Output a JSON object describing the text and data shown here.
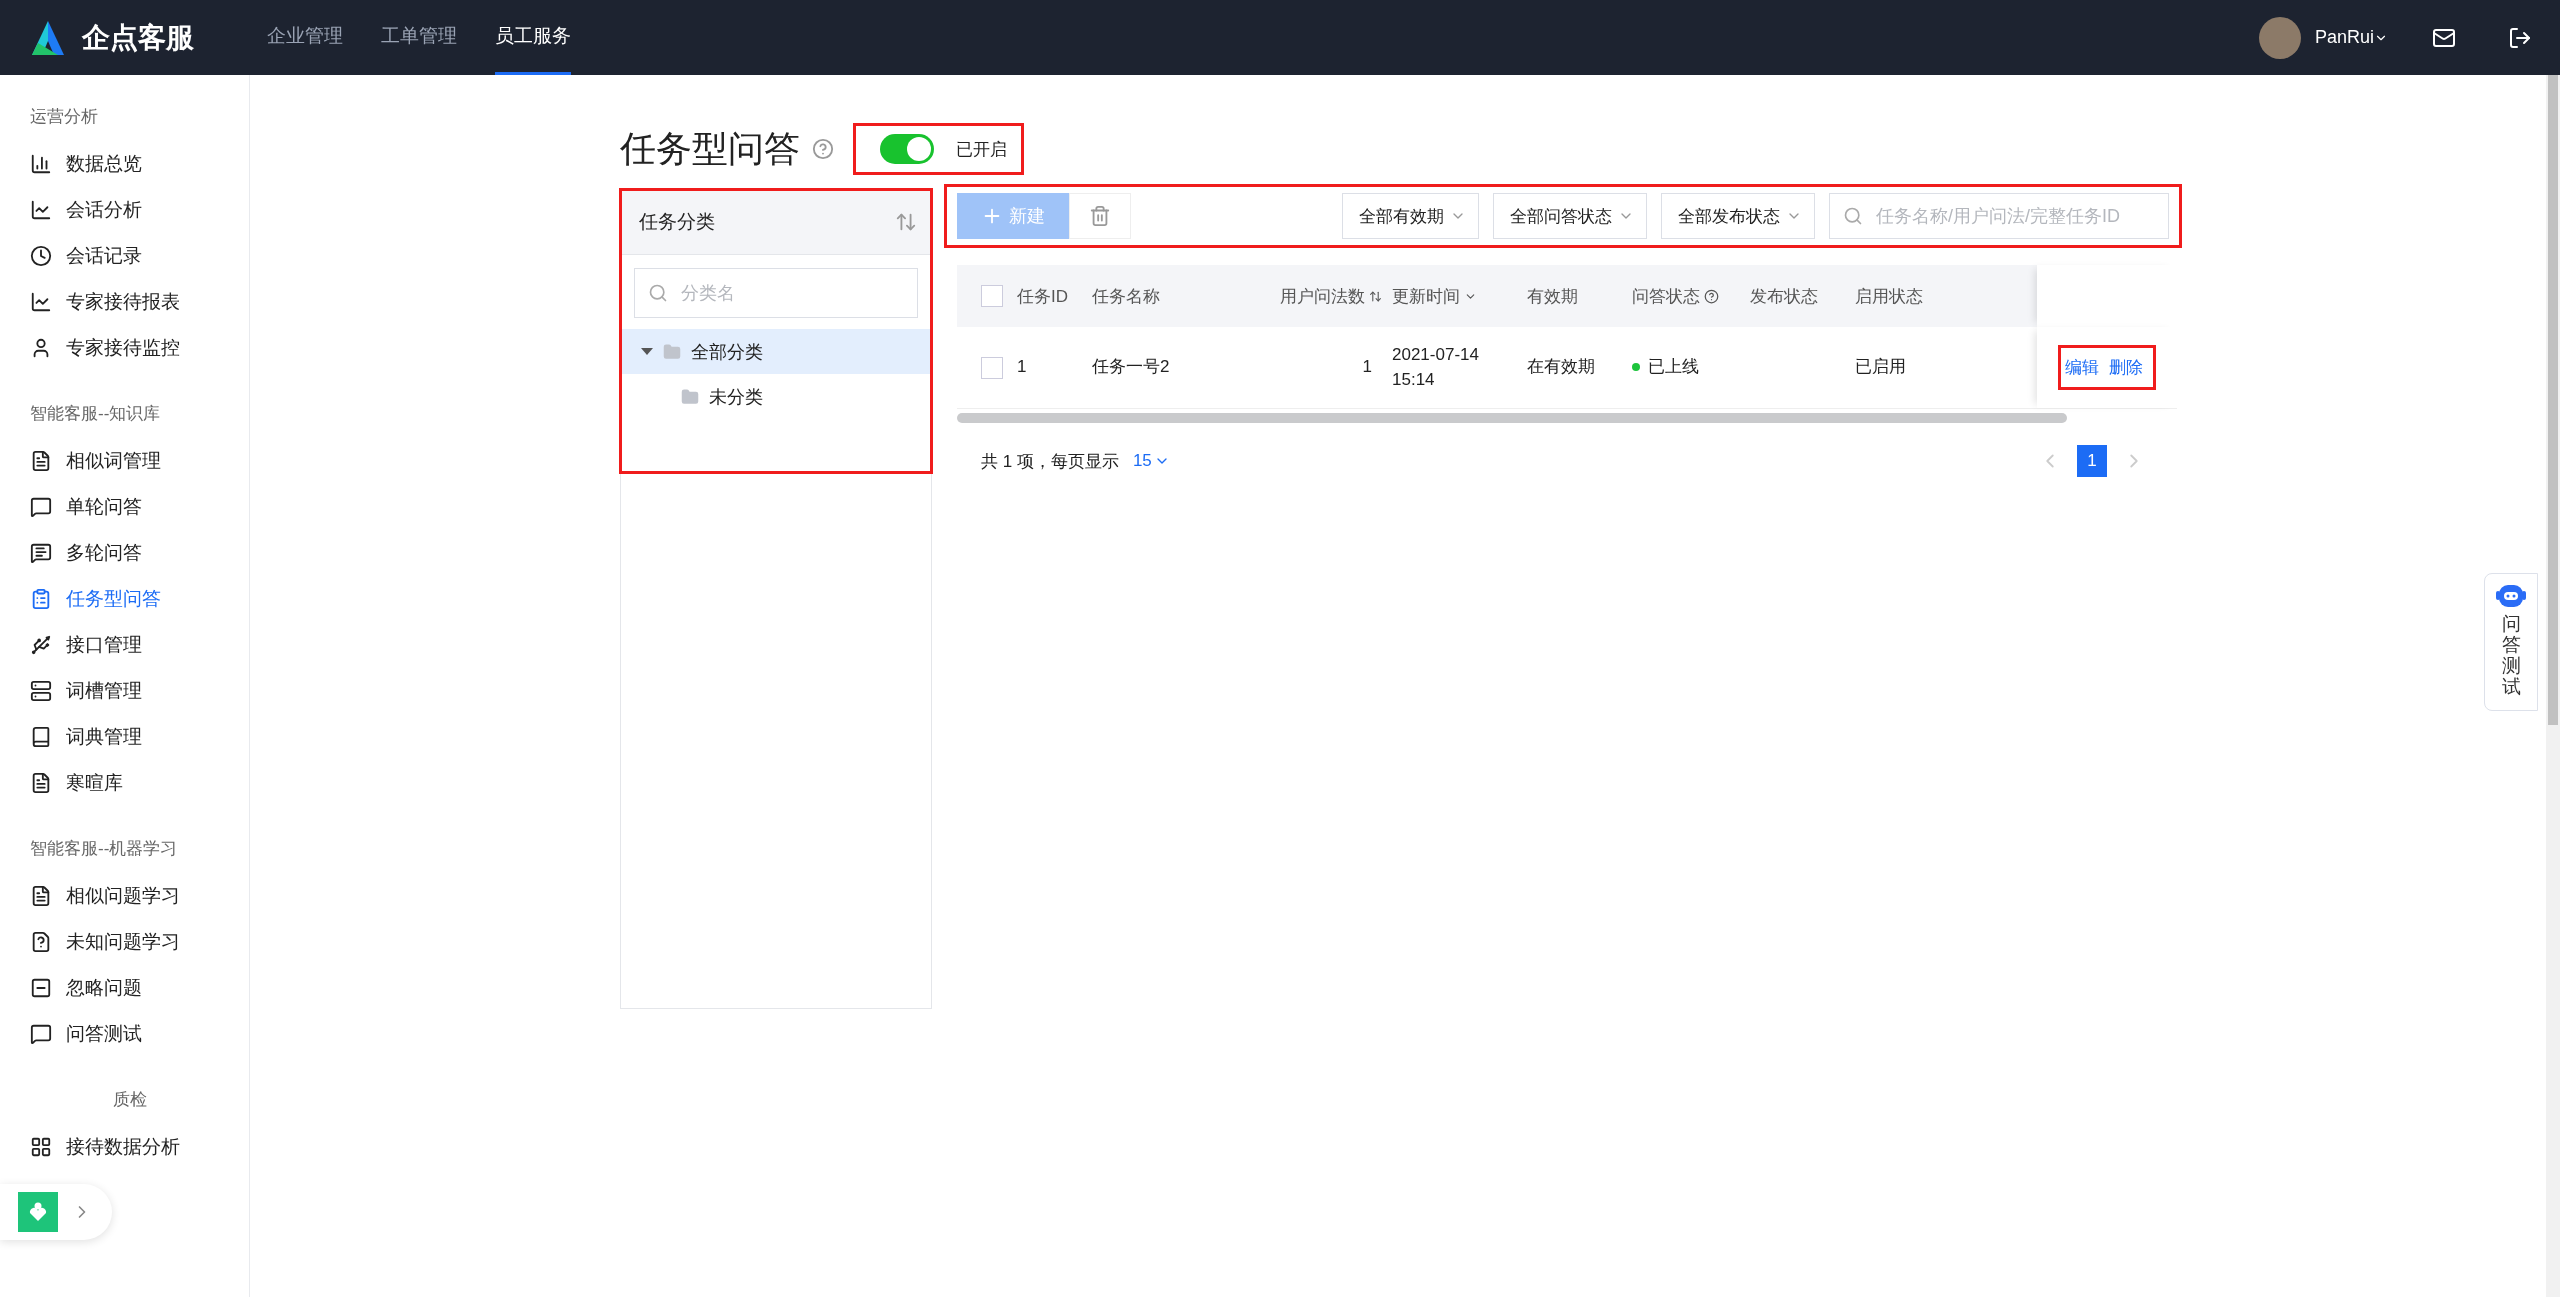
{
  "topbar": {
    "brand": "企点客服",
    "nav": [
      {
        "label": "企业管理",
        "selected": false
      },
      {
        "label": "工单管理",
        "selected": false
      },
      {
        "label": "员工服务",
        "selected": true
      }
    ],
    "user": "PanRui"
  },
  "sidebar": {
    "groups": [
      {
        "label": "运营分析",
        "items": [
          {
            "label": "数据总览",
            "selected": false
          },
          {
            "label": "会话分析",
            "selected": false
          },
          {
            "label": "会话记录",
            "selected": false
          },
          {
            "label": "专家接待报表",
            "selected": false
          },
          {
            "label": "专家接待监控",
            "selected": false
          }
        ]
      },
      {
        "label": "智能客服--知识库",
        "items": [
          {
            "label": "相似词管理",
            "selected": false
          },
          {
            "label": "单轮问答",
            "selected": false
          },
          {
            "label": "多轮问答",
            "selected": false
          },
          {
            "label": "任务型问答",
            "selected": true
          },
          {
            "label": "接口管理",
            "selected": false
          },
          {
            "label": "词槽管理",
            "selected": false
          },
          {
            "label": "词典管理",
            "selected": false
          },
          {
            "label": "寒暄库",
            "selected": false
          }
        ]
      },
      {
        "label": "智能客服--机器学习",
        "items": [
          {
            "label": "相似问题学习",
            "selected": false
          },
          {
            "label": "未知问题学习",
            "selected": false
          },
          {
            "label": "忽略问题",
            "selected": false
          },
          {
            "label": "问答测试",
            "selected": false
          }
        ]
      },
      {
        "label": "质检",
        "items": [
          {
            "label": "接待数据分析",
            "selected": false
          }
        ]
      }
    ]
  },
  "page": {
    "title": "任务型问答",
    "toggle": {
      "on": true,
      "label": "已开启",
      "annotated": true
    }
  },
  "category_panel": {
    "title": "任务分类",
    "annotated": true,
    "search": {
      "placeholder": "分类名"
    },
    "tree": [
      {
        "label": "全部分类",
        "expanded": true,
        "selected": true,
        "children": [
          {
            "label": "未分类",
            "selected": false
          }
        ]
      }
    ]
  },
  "toolbar": {
    "annotated": true,
    "new_button": "新建",
    "filters": [
      "全部有效期",
      "全部问答状态",
      "全部发布状态"
    ],
    "search": {
      "placeholder": "任务名称/用户问法/完整任务ID"
    }
  },
  "table": {
    "select_all": {
      "checked": false
    },
    "columns": [
      {
        "label": "任务ID",
        "kind": "plain"
      },
      {
        "label": "任务名称",
        "kind": "plain"
      },
      {
        "label": "用户问法数",
        "kind": "sort"
      },
      {
        "label": "更新时间",
        "kind": "sortdesc"
      },
      {
        "label": "有效期",
        "kind": "plain"
      },
      {
        "label": "问答状态",
        "kind": "help"
      },
      {
        "label": "发布状态",
        "kind": "plain"
      },
      {
        "label": "启用状态",
        "kind": "plain"
      }
    ],
    "rows": [
      {
        "checked": false,
        "task_id": "1",
        "task_name": "任务一号2",
        "question_count": "1",
        "updated": "2021-07-14 15:14",
        "validity": "在有效期",
        "status": {
          "label": "已上线",
          "color": "#1dc43c"
        },
        "enabled": "已启用",
        "actions": [
          "编辑",
          "删除"
        ],
        "actions_annotated": true
      }
    ]
  },
  "pagination": {
    "summary": "共 1 项，每页显示",
    "page_size": "15",
    "pages": [
      {
        "label": "1",
        "selected": true
      }
    ]
  },
  "float_widget": {
    "label": "问答测试"
  }
}
